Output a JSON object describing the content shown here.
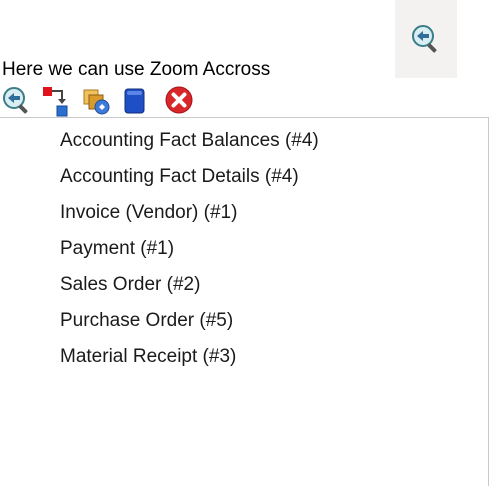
{
  "caption": "Here we can use Zoom Accross",
  "toolbar": {
    "buttons": [
      {
        "icon": "zoom-across-icon"
      },
      {
        "icon": "request-icon"
      },
      {
        "icon": "archive-icon"
      },
      {
        "icon": "blue-box-icon"
      },
      {
        "icon": "close-icon"
      }
    ]
  },
  "menu": {
    "items": [
      {
        "label": "Accounting Fact Balances (#4)"
      },
      {
        "label": "Accounting Fact Details (#4)"
      },
      {
        "label": "Invoice (Vendor) (#1)"
      },
      {
        "label": "Payment (#1)"
      },
      {
        "label": "Sales Order (#2)"
      },
      {
        "label": "Purchase Order (#5)"
      },
      {
        "label": "Material Receipt (#3)"
      }
    ]
  },
  "colors": {
    "close_red": "#d9262b",
    "blue_box": "#1f4fc4",
    "magnifier_teal": "#4aa7b3"
  }
}
